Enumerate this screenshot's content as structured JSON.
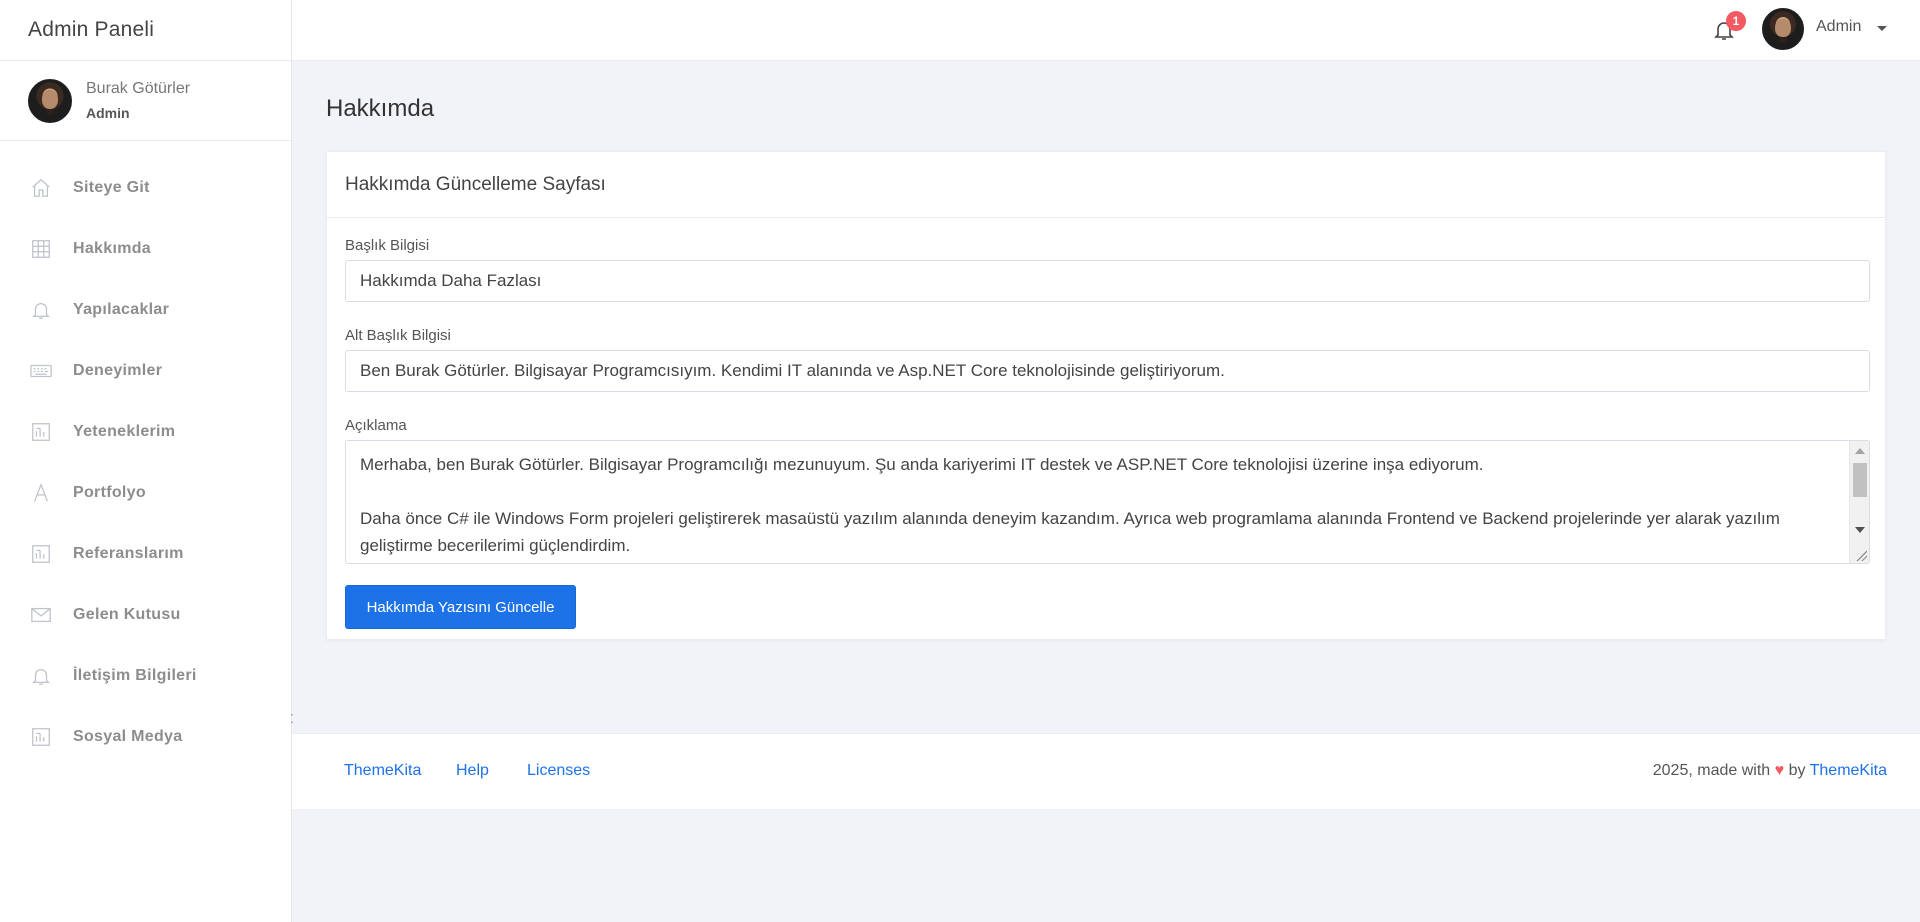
{
  "sidebar": {
    "brand": "Admin Paneli",
    "user": {
      "name": "Burak Götürler",
      "role": "Admin"
    },
    "items": [
      {
        "label": "Siteye Git",
        "icon": "home-icon"
      },
      {
        "label": "Hakkımda",
        "icon": "grid-icon"
      },
      {
        "label": "Yapılacaklar",
        "icon": "bell-icon"
      },
      {
        "label": "Deneyimler",
        "icon": "keyboard-icon"
      },
      {
        "label": "Yeteneklerim",
        "icon": "chart-box-icon"
      },
      {
        "label": "Portfolyo",
        "icon": "letter-a-icon"
      },
      {
        "label": "Referanslarım",
        "icon": "chart-box-icon"
      },
      {
        "label": "Gelen Kutusu",
        "icon": "envelope-icon"
      },
      {
        "label": "İletişim Bilgileri",
        "icon": "bell-icon"
      },
      {
        "label": "Sosyal Medya",
        "icon": "chart-box-icon"
      }
    ]
  },
  "topbar": {
    "notification_count": "1",
    "user_name": "Admin"
  },
  "page": {
    "title": "Hakkımda",
    "card_title": "Hakkımda Güncelleme Sayfası"
  },
  "form": {
    "title_label": "Başlık Bilgisi",
    "title_value": "Hakkımda Daha Fazlası",
    "subtitle_label": "Alt Başlık Bilgisi",
    "subtitle_value": "Ben Burak Götürler. Bilgisayar Programcısıyım. Kendimi IT alanında ve Asp.NET Core teknolojisinde geliştiriyorum.",
    "description_label": "Açıklama",
    "description_paragraph_1": "Merhaba, ben Burak Götürler. Bilgisayar Programcılığı mezunuyum. Şu anda kariyerimi IT destek ve ASP.NET Core teknolojisi üzerine inşa ediyorum.",
    "description_paragraph_2": "Daha önce C# ile Windows Form projeleri geliştirerek masaüstü yazılım alanında deneyim kazandım. Ayrıca web programlama alanında Frontend ve Backend projelerinde yer alarak yazılım geliştirme becerilerimi güçlendirdim.",
    "submit_label": "Hakkımda Yazısını Güncelle"
  },
  "footer": {
    "links": [
      "ThemeKita",
      "Help",
      "Licenses"
    ],
    "copyright_prefix": "2025, made with",
    "copyright_by": "by",
    "copyright_brand": "ThemeKita"
  },
  "colors": {
    "primary": "#1d72e8",
    "badge": "#f25961",
    "background": "#f2f3f8"
  }
}
